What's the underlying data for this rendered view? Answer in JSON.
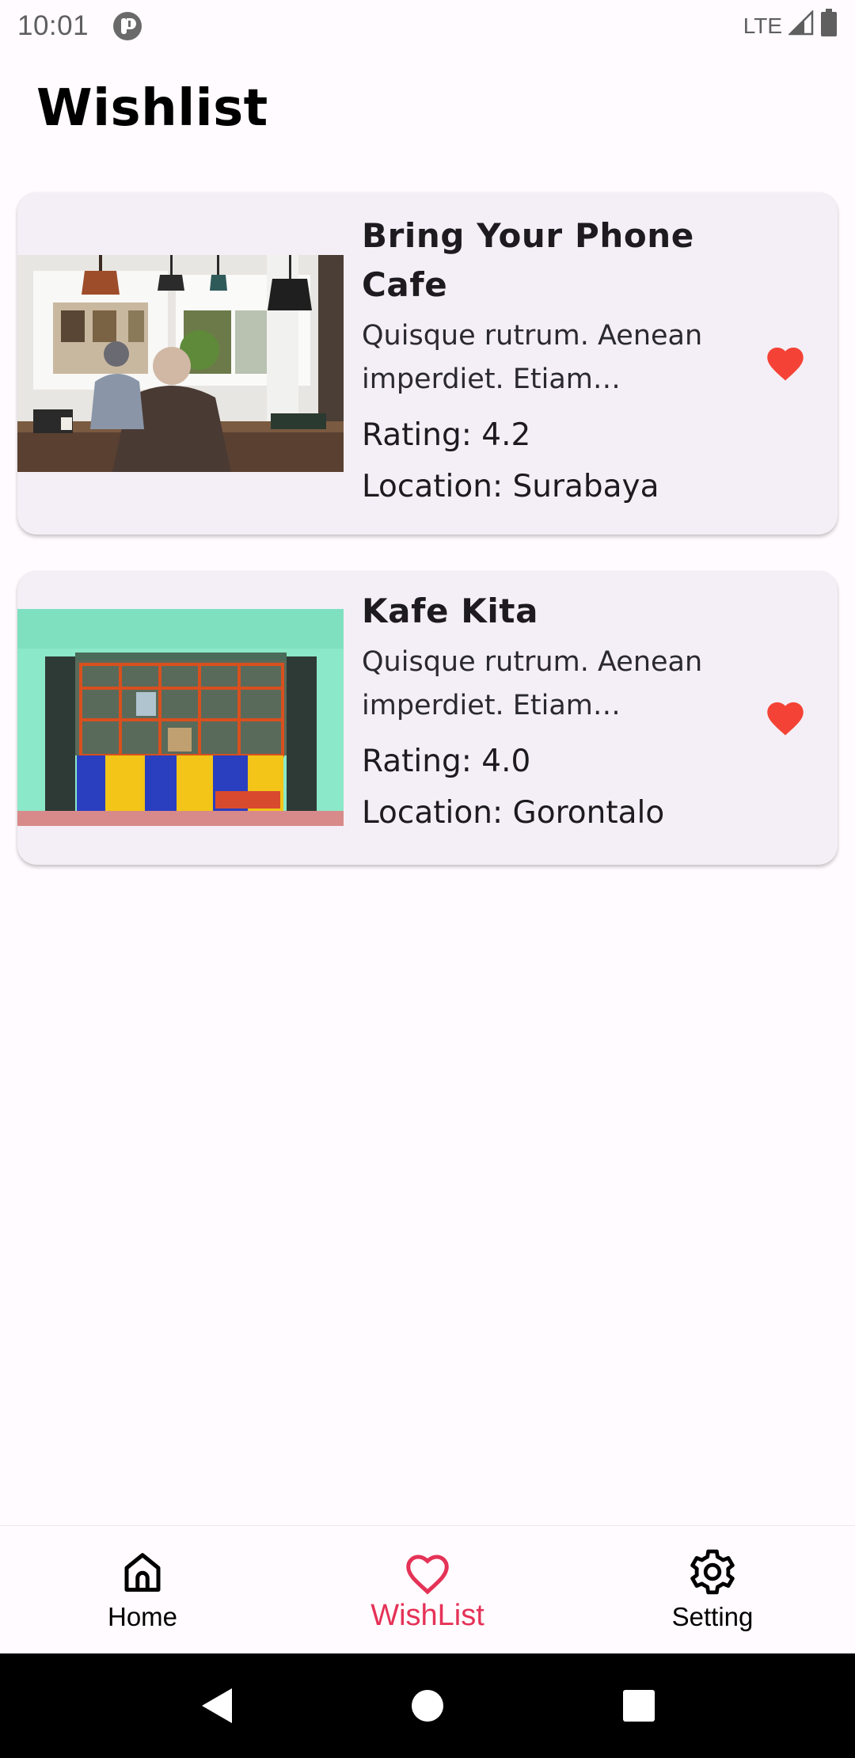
{
  "status_bar": {
    "time": "10:01",
    "network": "LTE",
    "app_icon": "notification-app-icon",
    "signal_icon": "cell-signal-icon",
    "battery_icon": "battery-icon"
  },
  "page": {
    "title": "Wishlist"
  },
  "wishlist": {
    "items": [
      {
        "name": "Bring Your Phone Cafe",
        "description": "Quisque rutrum. Aenean imperdiet. Etiam ultricies nisi vel augue.",
        "rating": "Rating: 4.2",
        "location": "Location: Surabaya",
        "favorite": true,
        "favorite_icon": "heart-icon"
      },
      {
        "name": "Kafe Kita",
        "description": "Quisque rutrum. Aenean imperdiet. Etiam ultricies nisi vel augue.",
        "rating": "Rating: 4.0",
        "location": "Location: Gorontalo",
        "favorite": true,
        "favorite_icon": "heart-icon"
      }
    ]
  },
  "bottom_nav": {
    "items": [
      {
        "label": "Home",
        "icon": "home-icon",
        "active": false
      },
      {
        "label": "WishList",
        "icon": "heart-outline-icon",
        "active": true
      },
      {
        "label": "Setting",
        "icon": "gear-icon",
        "active": false
      }
    ]
  },
  "system_nav": {
    "back_icon": "back-triangle-icon",
    "home_icon": "home-circle-icon",
    "recents_icon": "recents-square-icon"
  },
  "colors": {
    "accent": "#e53257",
    "heart": "#f44336",
    "card_background": "#f4eff6",
    "page_background": "#fffbfe"
  }
}
